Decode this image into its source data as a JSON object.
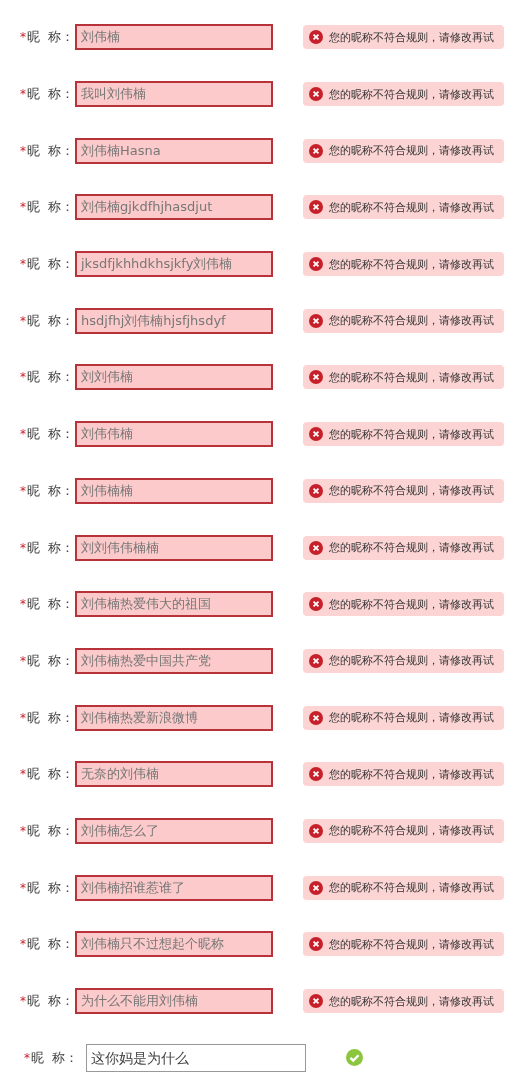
{
  "rows": [
    {
      "required_mark": "*",
      "label": "昵  称：",
      "value": "刘伟楠",
      "valid": false,
      "message": "您的昵称不符合规则，请修改再试"
    },
    {
      "required_mark": "*",
      "label": "昵  称：",
      "value": "我叫刘伟楠",
      "valid": false,
      "message": "您的昵称不符合规则，请修改再试"
    },
    {
      "required_mark": "*",
      "label": "昵  称：",
      "value": "刘伟楠Hasna",
      "valid": false,
      "message": "您的昵称不符合规则，请修改再试"
    },
    {
      "required_mark": "*",
      "label": "昵  称：",
      "value": "刘伟楠gjkdfhjhasdjut",
      "valid": false,
      "message": "您的昵称不符合规则，请修改再试"
    },
    {
      "required_mark": "*",
      "label": "昵  称：",
      "value": "jksdfjkhhdkhsjkfy刘伟楠",
      "valid": false,
      "message": "您的昵称不符合规则，请修改再试"
    },
    {
      "required_mark": "*",
      "label": "昵  称：",
      "value": "hsdjfhj刘伟楠hjsfjhsdyf",
      "valid": false,
      "message": "您的昵称不符合规则，请修改再试"
    },
    {
      "required_mark": "*",
      "label": "昵  称：",
      "value": "刘刘伟楠",
      "valid": false,
      "message": "您的昵称不符合规则，请修改再试"
    },
    {
      "required_mark": "*",
      "label": "昵  称：",
      "value": "刘伟伟楠",
      "valid": false,
      "message": "您的昵称不符合规则，请修改再试"
    },
    {
      "required_mark": "*",
      "label": "昵  称：",
      "value": "刘伟楠楠",
      "valid": false,
      "message": "您的昵称不符合规则，请修改再试"
    },
    {
      "required_mark": "*",
      "label": "昵  称：",
      "value": "刘刘伟伟楠楠",
      "valid": false,
      "message": "您的昵称不符合规则，请修改再试"
    },
    {
      "required_mark": "*",
      "label": "昵  称：",
      "value": "刘伟楠热爱伟大的祖国",
      "valid": false,
      "message": "您的昵称不符合规则，请修改再试"
    },
    {
      "required_mark": "*",
      "label": "昵  称：",
      "value": "刘伟楠热爱中国共产党",
      "valid": false,
      "message": "您的昵称不符合规则，请修改再试"
    },
    {
      "required_mark": "*",
      "label": "昵  称：",
      "value": "刘伟楠热爱新浪微博",
      "valid": false,
      "message": "您的昵称不符合规则，请修改再试"
    },
    {
      "required_mark": "*",
      "label": "昵  称：",
      "value": "无奈的刘伟楠",
      "valid": false,
      "message": "您的昵称不符合规则，请修改再试"
    },
    {
      "required_mark": "*",
      "label": "昵  称：",
      "value": "刘伟楠怎么了",
      "valid": false,
      "message": "您的昵称不符合规则，请修改再试"
    },
    {
      "required_mark": "*",
      "label": "昵  称：",
      "value": "刘伟楠招谁惹谁了",
      "valid": false,
      "message": "您的昵称不符合规则，请修改再试"
    },
    {
      "required_mark": "*",
      "label": "昵  称：",
      "value": "刘伟楠只不过想起个昵称",
      "valid": false,
      "message": "您的昵称不符合规则，请修改再试"
    },
    {
      "required_mark": "*",
      "label": "昵  称：",
      "value": "为什么不能用刘伟楠",
      "valid": false,
      "message": "您的昵称不符合规则，请修改再试"
    },
    {
      "required_mark": "*",
      "label": "昵  称：",
      "value": "这你妈是为什么",
      "valid": true
    }
  ]
}
